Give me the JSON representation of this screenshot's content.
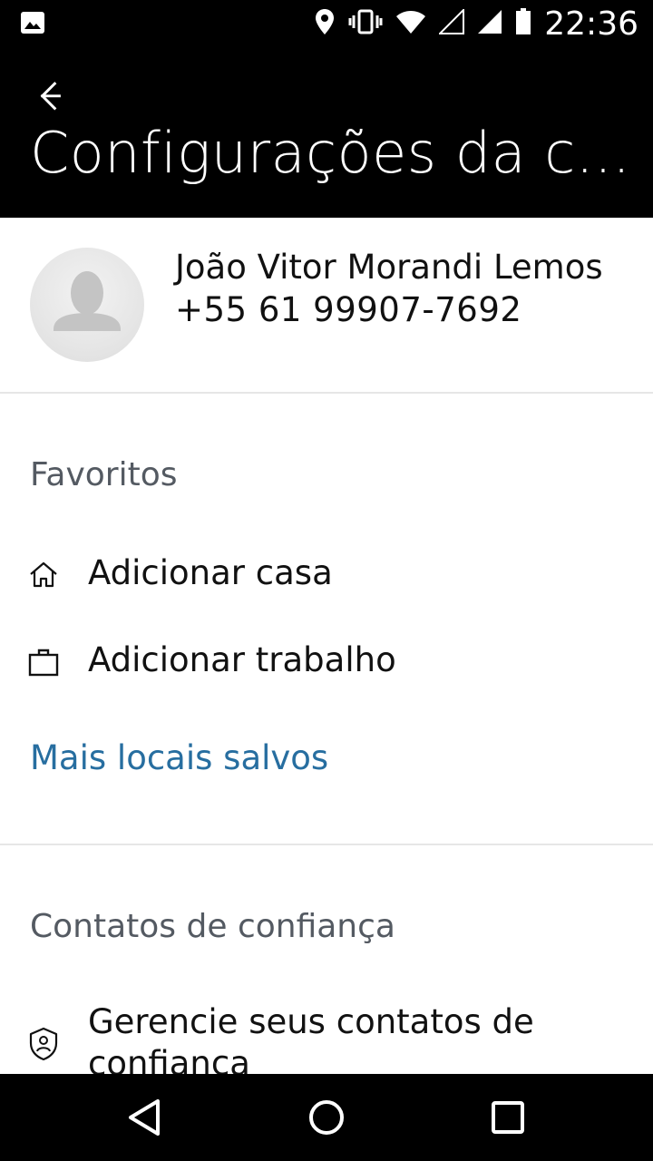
{
  "status_bar": {
    "time": "22:36",
    "icons": [
      "image-notification-icon",
      "location-icon",
      "vibrate-icon",
      "wifi-icon",
      "signal-empty-icon",
      "signal-full-icon",
      "battery-icon"
    ]
  },
  "app_bar": {
    "title": "Configurações da c...",
    "back_icon": "arrow-back-icon"
  },
  "profile": {
    "name": "João Vitor Morandi Lemos",
    "phone": "+55 61 99907-7692",
    "avatar_icon": "person-placeholder-icon"
  },
  "favorites": {
    "title": "Favoritos",
    "items": [
      {
        "label": "Adicionar casa",
        "icon": "home-icon"
      },
      {
        "label": "Adicionar trabalho",
        "icon": "briefcase-icon"
      }
    ],
    "more_link": "Mais locais salvos"
  },
  "trusted_contacts": {
    "title": "Contatos de confiança",
    "items": [
      {
        "label": "Gerencie seus contatos de confiança",
        "icon": "shield-person-icon"
      }
    ]
  },
  "nav_bar": {
    "icons": [
      "back-triangle-icon",
      "home-circle-icon",
      "recents-square-icon"
    ]
  },
  "colors": {
    "link": "#276ea0",
    "section_title": "#545a62",
    "app_bar_bg": "#000000"
  }
}
